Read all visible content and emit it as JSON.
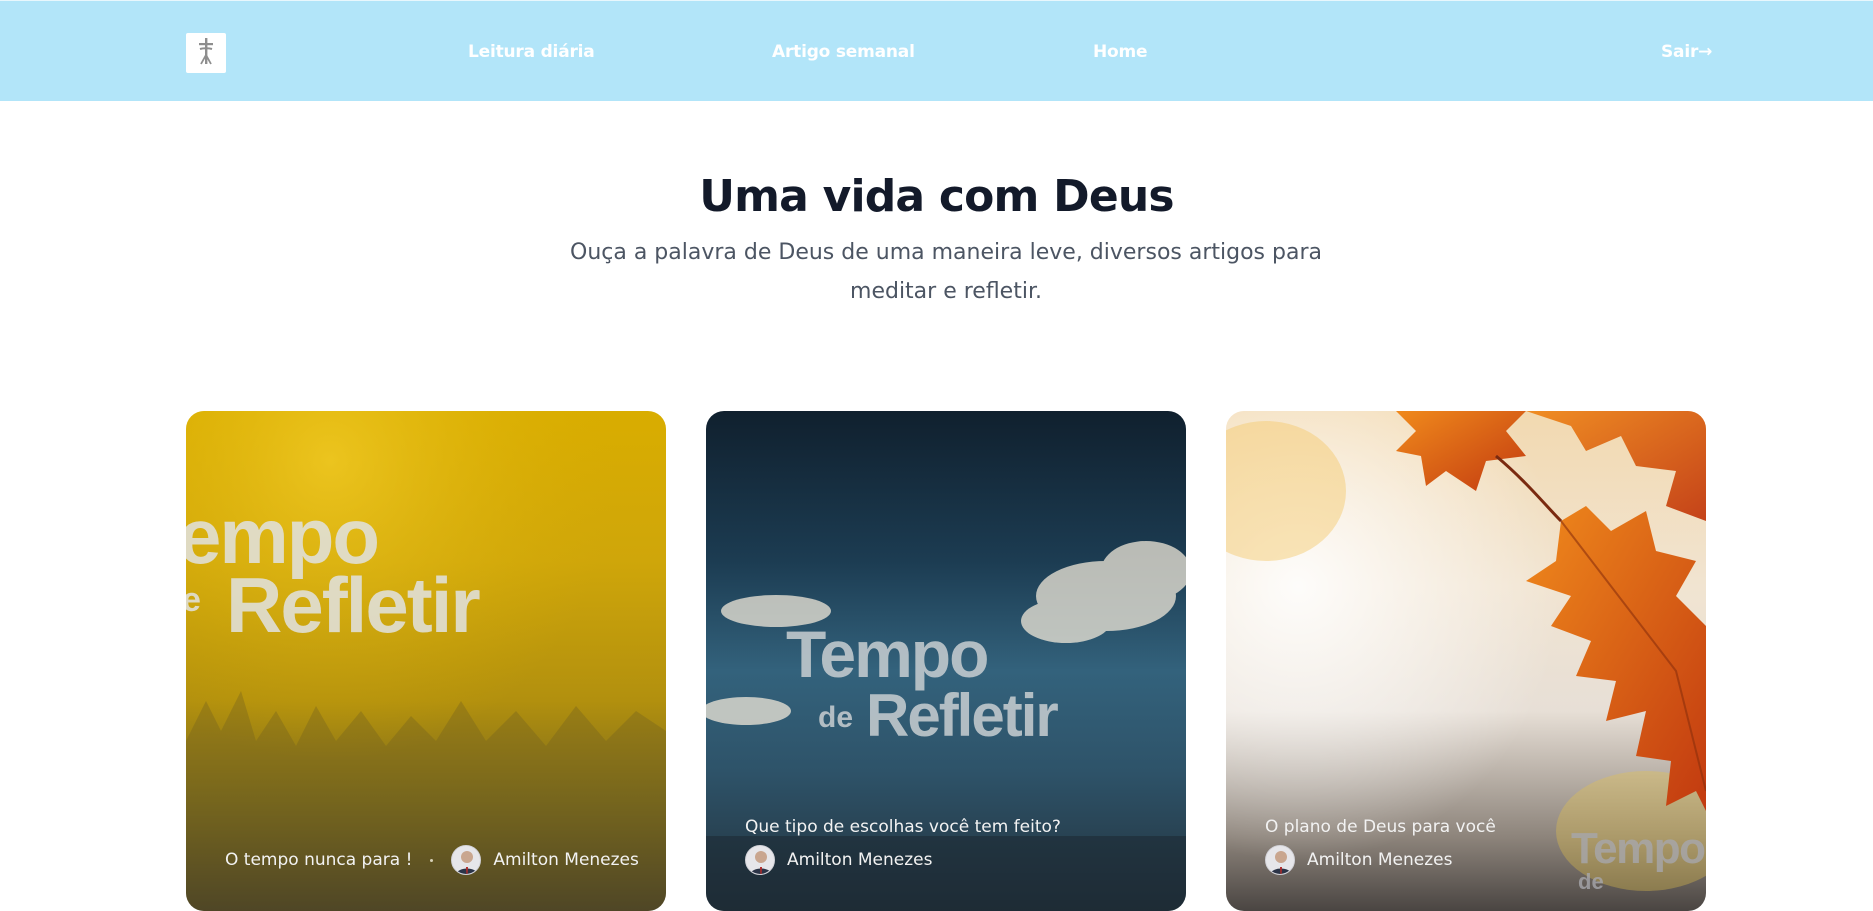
{
  "header": {
    "logo_icon": "cross-icon",
    "nav": [
      {
        "label": "Leitura diária"
      },
      {
        "label": "Artigo semanal"
      },
      {
        "label": "Home"
      }
    ],
    "exit_label": "Sair→"
  },
  "hero": {
    "title": "Uma vida com Deus",
    "subtitle": "Ouça a palavra de Deus de uma maneira leve, diversos artigos para meditar e refletir."
  },
  "cards": [
    {
      "title": "O tempo nunca para !",
      "author": "Amilton Menezes",
      "image_text": [
        "empo",
        "Refletir"
      ],
      "image_text_small": "e"
    },
    {
      "title": "Que tipo de escolhas você tem feito?",
      "author": "Amilton Menezes",
      "image_text": [
        "Tempo",
        "Refletir"
      ],
      "image_text_small": "de"
    },
    {
      "title": "O plano de Deus para você",
      "author": "Amilton Menezes",
      "image_text": [
        "Tempo"
      ],
      "image_text_small": "de"
    }
  ],
  "colors": {
    "header_bg": "#b2e5f9",
    "title": "#131a2a",
    "subtitle": "#4c5563"
  }
}
